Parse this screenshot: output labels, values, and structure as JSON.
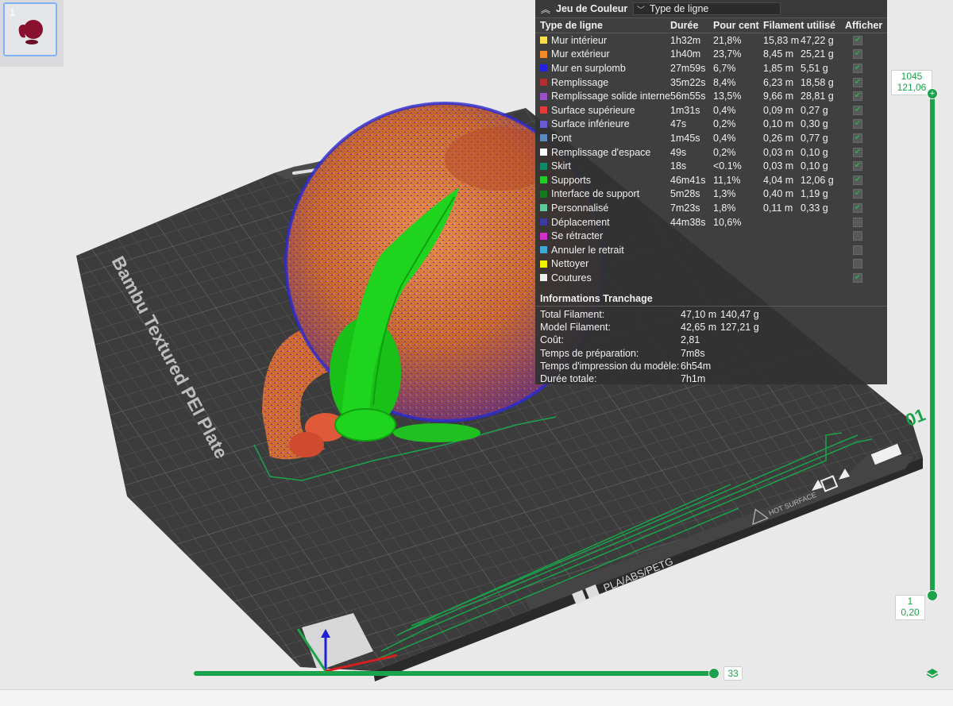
{
  "plate_thumbnail": {
    "number": "1"
  },
  "stats_panel": {
    "header": {
      "title": "Jeu de Couleur",
      "dropdown_value": "Type de ligne"
    },
    "columns": [
      "Type de ligne",
      "Durée",
      "Pour cent",
      "Filament utilisé",
      "Afficher"
    ],
    "rows": [
      {
        "type": "Mur intérieur",
        "color": "#f7e04a",
        "duration": "1h32m",
        "percent": "21,8%",
        "length": "15,83 m",
        "weight": "47,22 g",
        "shown": true
      },
      {
        "type": "Mur extérieur",
        "color": "#f08a24",
        "duration": "1h40m",
        "percent": "23,7%",
        "length": "8,45 m",
        "weight": "25,21 g",
        "shown": true
      },
      {
        "type": "Mur en surplomb",
        "color": "#2222e0",
        "duration": "27m59s",
        "percent": "6,7%",
        "length": "1,85 m",
        "weight": "5,51 g",
        "shown": true
      },
      {
        "type": "Remplissage",
        "color": "#b03030",
        "duration": "35m22s",
        "percent": "8,4%",
        "length": "6,23 m",
        "weight": "18,58 g",
        "shown": true
      },
      {
        "type": "Remplissage solide interne",
        "color": "#9a50c8",
        "duration": "56m55s",
        "percent": "13,5%",
        "length": "9,66 m",
        "weight": "28,81 g",
        "shown": true
      },
      {
        "type": "Surface supérieure",
        "color": "#e83a3a",
        "duration": "1m31s",
        "percent": "0,4%",
        "length": "0,09 m",
        "weight": "0,27 g",
        "shown": true
      },
      {
        "type": "Surface inférieure",
        "color": "#6a5ad0",
        "duration": "47s",
        "percent": "0,2%",
        "length": "0,10 m",
        "weight": "0,30 g",
        "shown": true
      },
      {
        "type": "Pont",
        "color": "#5a8ac0",
        "duration": "1m45s",
        "percent": "0,4%",
        "length": "0,26 m",
        "weight": "0,77 g",
        "shown": true
      },
      {
        "type": "Remplissage d'espace",
        "color": "#ffffff",
        "duration": "49s",
        "percent": "0,2%",
        "length": "0,03 m",
        "weight": "0,10 g",
        "shown": true
      },
      {
        "type": "Skirt",
        "color": "#0e8a6a",
        "duration": "18s",
        "percent": "<0.1%",
        "length": "0,03 m",
        "weight": "0,10 g",
        "shown": true
      },
      {
        "type": "Supports",
        "color": "#22cc22",
        "duration": "46m41s",
        "percent": "11,1%",
        "length": "4,04 m",
        "weight": "12,06 g",
        "shown": true
      },
      {
        "type": "Interface de support",
        "color": "#157a1e",
        "duration": "5m28s",
        "percent": "1,3%",
        "length": "0,40 m",
        "weight": "1,19 g",
        "shown": true
      },
      {
        "type": "Personnalisé",
        "color": "#5ec89a",
        "duration": "7m23s",
        "percent": "1,8%",
        "length": "0,11 m",
        "weight": "0,33 g",
        "shown": true
      },
      {
        "type": "Déplacement",
        "color": "#3a3aa0",
        "duration": "44m38s",
        "percent": "10,6%",
        "length": "",
        "weight": "",
        "shown": false
      },
      {
        "type": "Se rétracter",
        "color": "#d030d0",
        "duration": "",
        "percent": "",
        "length": "",
        "weight": "",
        "shown": false
      },
      {
        "type": "Annuler le retrait",
        "color": "#40a8d8",
        "duration": "",
        "percent": "",
        "length": "",
        "weight": "",
        "shown": false
      },
      {
        "type": "Nettoyer",
        "color": "#f2f200",
        "duration": "",
        "percent": "",
        "length": "",
        "weight": "",
        "shown": false
      },
      {
        "type": "Coutures",
        "color": "#eeeeee",
        "duration": "",
        "percent": "",
        "length": "",
        "weight": "",
        "shown": true
      }
    ],
    "info": {
      "title": "Informations Tranchage",
      "items": [
        {
          "label": "Total Filament:",
          "v1": "47,10 m",
          "v2": "140,47 g"
        },
        {
          "label": "Model Filament:",
          "v1": "42,65 m",
          "v2": "127,21 g"
        },
        {
          "label": "Coût:",
          "v1": "2,81",
          "v2": ""
        },
        {
          "label": "Temps de préparation:",
          "v1": "7m8s",
          "v2": ""
        },
        {
          "label": "Temps d'impression du modèle:",
          "v1": "6h54m",
          "v2": ""
        },
        {
          "label": "Durée totale:",
          "v1": "7h1m",
          "v2": ""
        }
      ]
    }
  },
  "plate": {
    "name": "Bambu Textured PEI Plate",
    "material_label": "PLA/ABS/PETG",
    "warning_label": "HOT SURFACE",
    "corner_number": "01"
  },
  "layer_slider": {
    "top_layer": "1045",
    "top_height": "121,06",
    "bottom_layer": "1",
    "bottom_height": "0,20"
  },
  "move_slider": {
    "value": "33"
  },
  "colors": {
    "accent": "#1aa34a",
    "panel_bg": "#323232",
    "plate": "#3c3c3c"
  }
}
